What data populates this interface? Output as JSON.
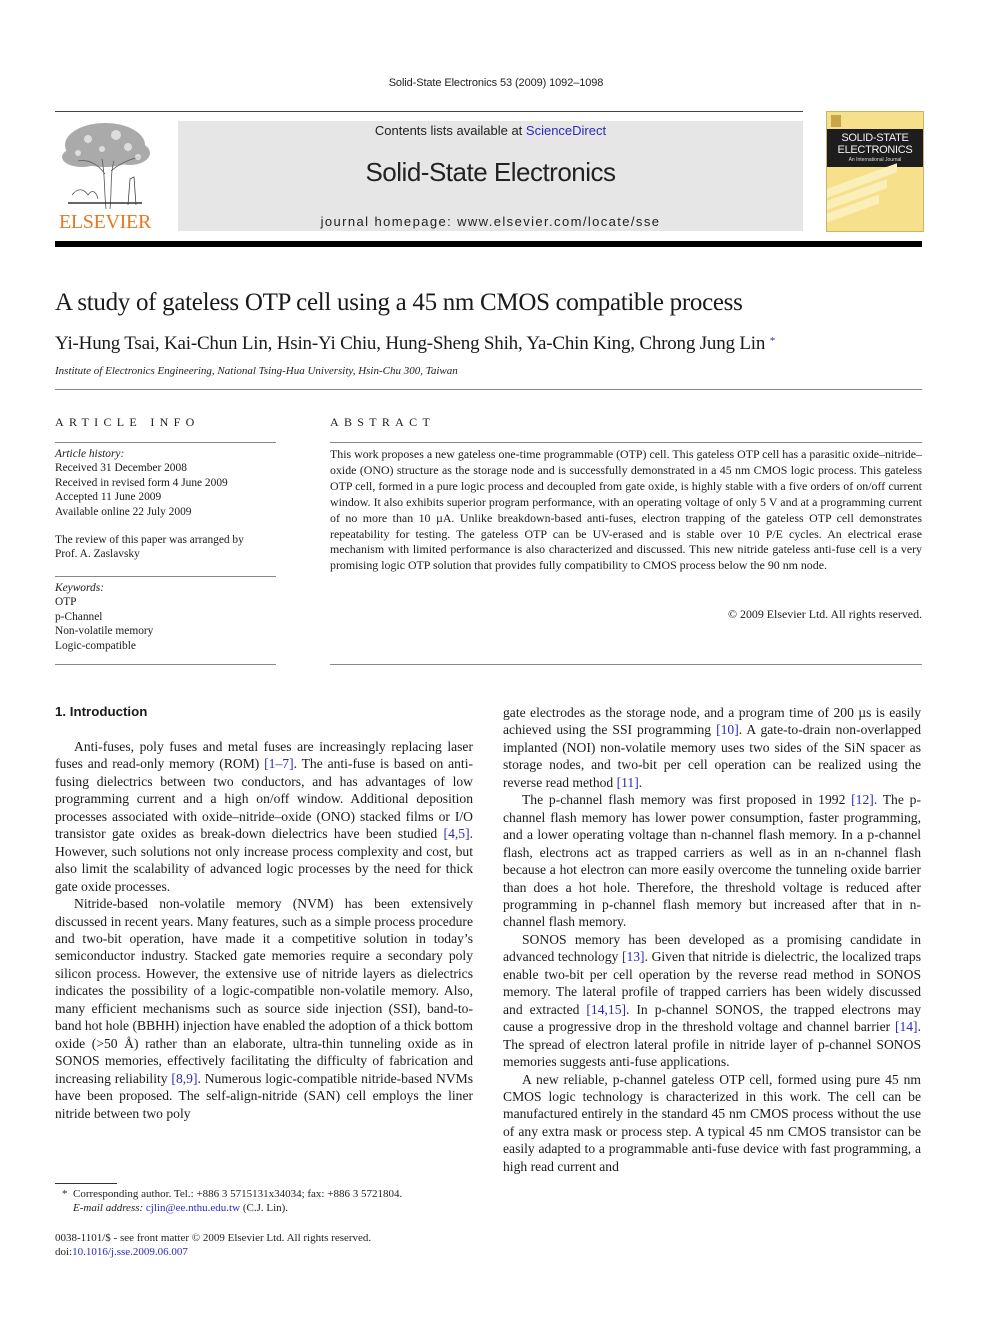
{
  "running_head": "Solid-State Electronics 53 (2009) 1092–1098",
  "masthead": {
    "publisher_logo_label": "ELSEVIER",
    "contents_prefix": "Contents lists available at ",
    "contents_link": "ScienceDirect",
    "journal_title": "Solid-State Electronics",
    "homepage_prefix": "journal homepage: ",
    "homepage_url_text": "www.elsevier.com/locate/sse",
    "cover_title_line1": "SOLID-STATE",
    "cover_title_line2": "ELECTRONICS",
    "cover_subtitle": "An International Journal",
    "colors": {
      "publisher_orange": "#e87722",
      "link_blue": "#2a2ac0",
      "cover_yellow": "#f6e08c",
      "masthead_gray": "#e6e6e6"
    }
  },
  "article": {
    "title": "A study of gateless OTP cell using a 45 nm CMOS compatible process",
    "authors": "Yi-Hung Tsai, Kai-Chun Lin, Hsin-Yi Chiu, Hung-Sheng Shih, Ya-Chin King, Chrong Jung Lin",
    "corresponding_mark": "*",
    "affiliation": "Institute of Electronics Engineering, National Tsing-Hua University, Hsin-Chu 300, Taiwan"
  },
  "article_info": {
    "heading": "ARTICLE INFO",
    "history_label": "Article history:",
    "history": [
      "Received 31 December 2008",
      "Received in revised form 4 June 2009",
      "Accepted 11 June 2009",
      "Available online 22 July 2009"
    ],
    "review_note_line1": "The review of this paper was arranged by",
    "review_note_line2": "Prof. A. Zaslavsky",
    "keywords_label": "Keywords:",
    "keywords": [
      "OTP",
      "p-Channel",
      "Non-volatile memory",
      "Logic-compatible"
    ]
  },
  "abstract": {
    "heading": "ABSTRACT",
    "text": "This work proposes a new gateless one-time programmable (OTP) cell. This gateless OTP cell has a parasitic oxide–nitride–oxide (ONO) structure as the storage node and is successfully demonstrated in a 45 nm CMOS logic process. This gateless OTP cell, formed in a pure logic process and decoupled from gate oxide, is highly stable with a five orders of on/off current window. It also exhibits superior program performance, with an operating voltage of only 5 V and at a programming current of no more than 10 µA. Unlike breakdown-based anti-fuses, electron trapping of the gateless OTP cell demonstrates repeatability for testing. The gateless OTP can be UV-erased and is stable over 10 P/E cycles. An electrical erase mechanism with limited performance is also characterized and discussed. This new nitride gateless anti-fuse cell is a very promising logic OTP solution that provides fully compatibility to CMOS process below the 90 nm node.",
    "copyright": "© 2009 Elsevier Ltd. All rights reserved."
  },
  "body": {
    "section_heading": "1. Introduction",
    "left_paragraphs": [
      {
        "segments": [
          {
            "t": "Anti-fuses, poly fuses and metal fuses are increasingly replacing laser fuses and read-only memory (ROM) "
          },
          {
            "t": "[1–7]",
            "ref": true
          },
          {
            "t": ". The anti-fuse is based on anti-fusing dielectrics between two conductors, and has advantages of low programming current and a high on/off window. Additional deposition processes associated with oxide–nitride–oxide (ONO) stacked films or I/O transistor gate oxides as break-down dielectrics have been studied "
          },
          {
            "t": "[4,5]",
            "ref": true
          },
          {
            "t": ". However, such solutions not only increase process complexity and cost, but also limit the scalability of advanced logic processes by the need for thick gate oxide processes."
          }
        ]
      },
      {
        "segments": [
          {
            "t": "Nitride-based non-volatile memory (NVM) has been extensively discussed in recent years. Many features, such as a simple process procedure and two-bit operation, have made it a competitive solution in today’s semiconductor industry. Stacked gate memories require a secondary poly silicon process. However, the extensive use of nitride layers as dielectrics indicates the possibility of a logic-compatible non-volatile memory. Also, many efficient mechanisms such as source side injection (SSI), band-to-band hot hole (BBHH) injection have enabled the adoption of a thick bottom oxide (>50 Å) rather than an elaborate, ultra-thin tunneling oxide as in SONOS memories, effectively facilitating the difficulty of fabrication and increasing reliability "
          },
          {
            "t": "[8,9]",
            "ref": true
          },
          {
            "t": ". Numerous logic-compatible nitride-based NVMs have been proposed. The self-align-nitride (SAN) cell employs the liner nitride between two poly"
          }
        ]
      }
    ],
    "right_paragraphs": [
      {
        "noindent": true,
        "segments": [
          {
            "t": "gate electrodes as the storage node, and a program time of 200 µs is easily achieved using the SSI programming "
          },
          {
            "t": "[10]",
            "ref": true
          },
          {
            "t": ". A gate-to-drain non-overlapped implanted (NOI) non-volatile memory uses two sides of the SiN spacer as storage nodes, and two-bit per cell operation can be realized using the reverse read method "
          },
          {
            "t": "[11]",
            "ref": true
          },
          {
            "t": "."
          }
        ]
      },
      {
        "segments": [
          {
            "t": "The p-channel flash memory was first proposed in 1992 "
          },
          {
            "t": "[12]",
            "ref": true
          },
          {
            "t": ". The p-channel flash memory has lower power consumption, faster programming, and a lower operating voltage than n-channel flash memory. In a p-channel flash, electrons act as trapped carriers as well as in an n-channel flash because a hot electron can more easily overcome the tunneling oxide barrier than does a hot hole. Therefore, the threshold voltage is reduced after programming in p-channel flash memory but increased after that in n-channel flash memory."
          }
        ]
      },
      {
        "segments": [
          {
            "t": "SONOS memory has been developed as a promising candidate in advanced technology "
          },
          {
            "t": "[13]",
            "ref": true
          },
          {
            "t": ". Given that nitride is dielectric, the localized traps enable two-bit per cell operation by the reverse read method in SONOS memory. The lateral profile of trapped carriers has been widely discussed and extracted "
          },
          {
            "t": "[14,15]",
            "ref": true
          },
          {
            "t": ". In p-channel SONOS, the trapped electrons may cause a progressive drop in the threshold voltage and channel barrier "
          },
          {
            "t": "[14]",
            "ref": true
          },
          {
            "t": ". The spread of electron lateral profile in nitride layer of p-channel SONOS memories suggests anti-fuse applications."
          }
        ]
      },
      {
        "segments": [
          {
            "t": "A new reliable, p-channel gateless OTP cell, formed using pure 45 nm CMOS logic technology is characterized in this work. The cell can be manufactured entirely in the standard 45 nm CMOS process without the use of any extra mask or process step. A typical 45 nm CMOS transistor can be easily adapted to a programmable anti-fuse device with fast programming, a high read current and"
          }
        ]
      }
    ]
  },
  "footnote": {
    "mark": "*",
    "line1": "Corresponding author. Tel.: +886 3 5715131x34034; fax: +886 3 5721804.",
    "email_label": "E-mail address: ",
    "email": "cjlin@ee.nthu.edu.tw",
    "email_suffix": " (C.J. Lin)."
  },
  "front_matter": {
    "issn_line": "0038-1101/$ - see front matter © 2009 Elsevier Ltd. All rights reserved.",
    "doi_prefix": "doi:",
    "doi": "10.1016/j.sse.2009.06.007"
  }
}
